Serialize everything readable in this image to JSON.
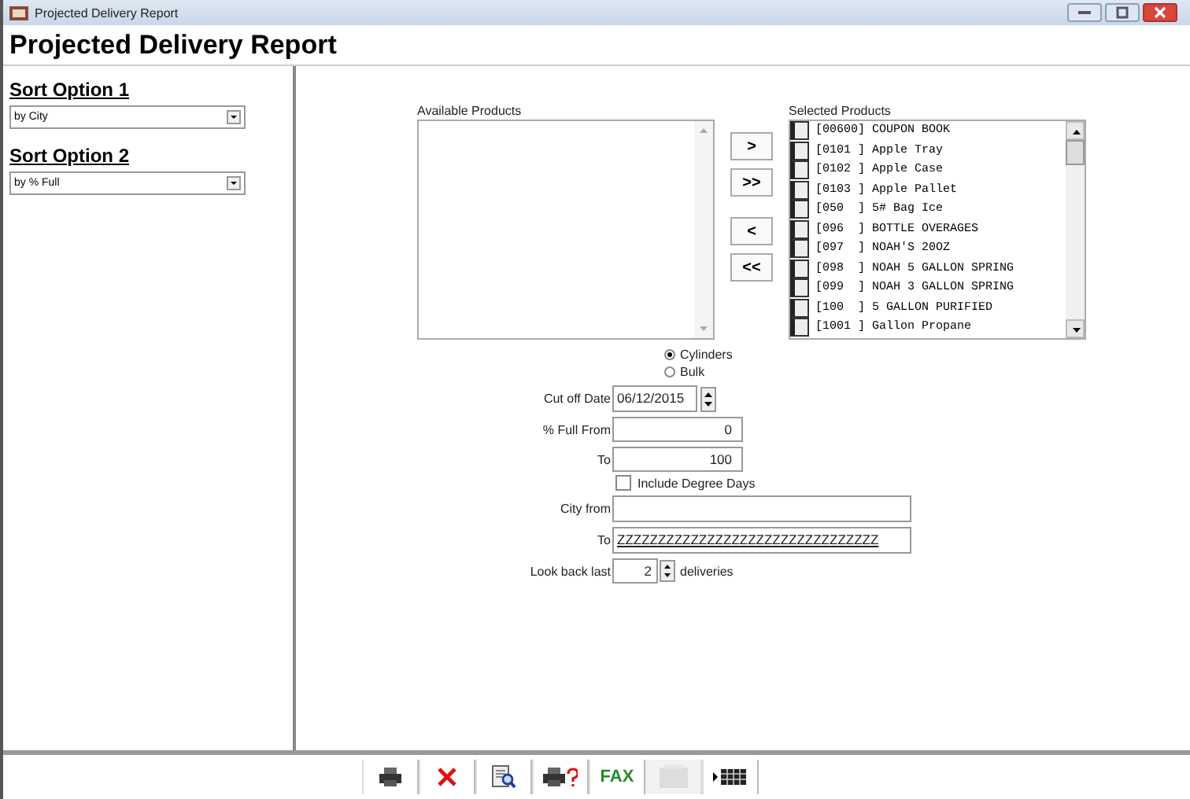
{
  "window": {
    "title": "Projected Delivery Report"
  },
  "heading": "Projected Delivery Report",
  "sort_options": [
    {
      "label": "Sort Option 1",
      "value": "by City"
    },
    {
      "label": "Sort Option 2",
      "value": "by % Full"
    }
  ],
  "available_products": {
    "label": "Available Products"
  },
  "move_buttons": [
    ">",
    ">>",
    "<",
    "<<"
  ],
  "selected_products": {
    "label": "Selected Products",
    "items": [
      {
        "text": "[00600] COUPON BOOK",
        "checked": false
      },
      {
        "text": "[0101 ] Apple Tray",
        "checked": false
      },
      {
        "text": "[0102 ] Apple Case",
        "checked": false
      },
      {
        "text": "[0103 ] Apple Pallet",
        "checked": false
      },
      {
        "text": "[050  ] 5# Bag Ice",
        "checked": false
      },
      {
        "text": "[096  ] BOTTLE OVERAGES",
        "checked": false
      },
      {
        "text": "[097  ] NOAH'S 20OZ",
        "checked": false
      },
      {
        "text": "[098  ] NOAH 5 GALLON SPRING",
        "checked": false
      },
      {
        "text": "[099  ] NOAH 3 GALLON SPRING",
        "checked": false
      },
      {
        "text": "[100  ] 5 GALLON PURIFIED",
        "checked": false
      },
      {
        "text": "[1001 ] Gallon Propane",
        "checked": false
      }
    ]
  },
  "type_options": [
    {
      "label": "Cylinders",
      "selected": true
    },
    {
      "label": "Bulk",
      "selected": false
    }
  ],
  "cut_off_date": {
    "label": "Cut off Date",
    "value": "06/12/2015"
  },
  "full_from": {
    "label": "% Full From",
    "value": "0"
  },
  "full_to": {
    "label": "To",
    "value": "100"
  },
  "include_degree_days": {
    "label": "Include Degree Days",
    "checked": false
  },
  "city_from": {
    "label": "City from"
  },
  "city_to": {
    "label": "To",
    "value": "ZZZZZZZZZZZZZZZZZZZZZZZZZZZZZZZZ"
  },
  "look_back": {
    "label": "Look back last",
    "value": "2",
    "unit": "deliveries"
  },
  "toolbar": [
    {
      "kind": "print",
      "disabled": false
    },
    {
      "kind": "cancel",
      "disabled": false
    },
    {
      "kind": "preview",
      "disabled": false
    },
    {
      "kind": "print-query",
      "disabled": false
    },
    {
      "kind": "fax",
      "text": "FAX",
      "disabled": false
    },
    {
      "kind": "blank",
      "disabled": true
    },
    {
      "kind": "grid",
      "disabled": false
    }
  ]
}
